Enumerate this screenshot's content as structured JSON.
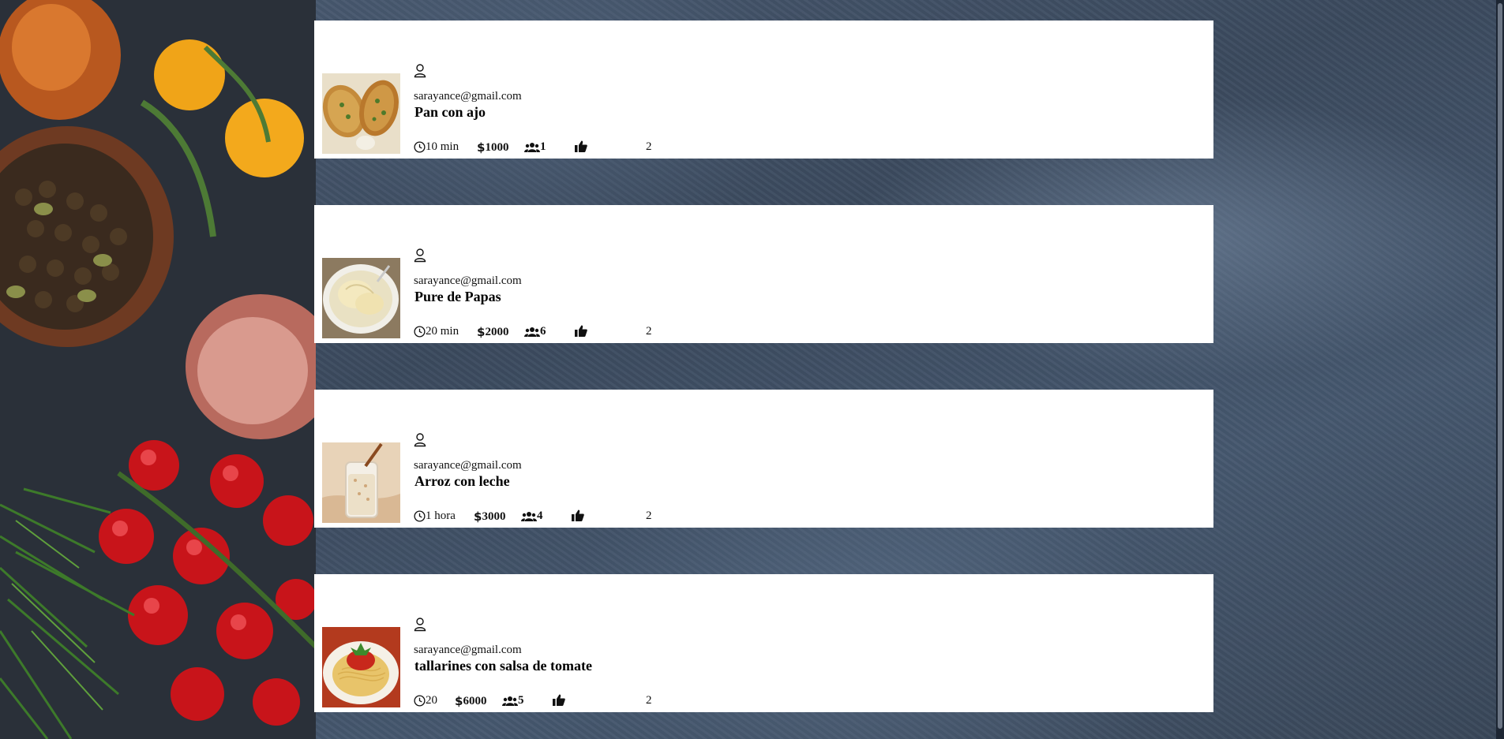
{
  "recipes": [
    {
      "author_email": "sarayance@gmail.com",
      "name": "Pan con ajo",
      "time": "10 min",
      "price": "1000",
      "servings": "1",
      "likes": "2"
    },
    {
      "author_email": "sarayance@gmail.com",
      "name": "Pure de Papas",
      "time": "20 min",
      "price": "2000",
      "servings": "6",
      "likes": "2"
    },
    {
      "author_email": "sarayance@gmail.com",
      "name": "Arroz con leche",
      "time": "1 hora",
      "price": "3000",
      "servings": "4",
      "likes": "2"
    },
    {
      "author_email": "sarayance@gmail.com",
      "name": "tallarines con salsa de tomate",
      "time": "20",
      "price": "6000",
      "servings": "5",
      "likes": "2"
    }
  ],
  "icons": {
    "author": "user-icon",
    "time": "clock-icon",
    "price": "dollar-icon",
    "servings": "users-icon",
    "likes": "thumbs-up-icon"
  },
  "colors": {
    "card_background": "#ffffff",
    "page_background": "#3f4e63"
  }
}
